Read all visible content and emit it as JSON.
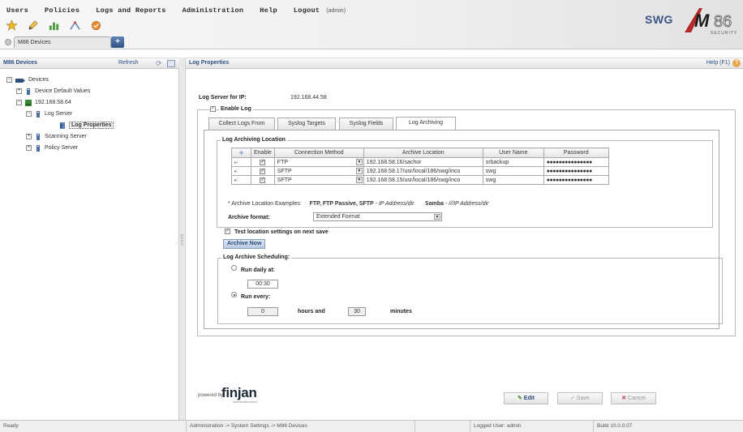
{
  "menu": {
    "items": [
      "Users",
      "Policies",
      "Logs and Reports",
      "Administration",
      "Help",
      "Logout"
    ],
    "user_tag": "(admin)"
  },
  "toolbar_icons": [
    "star-icon",
    "pencil-icon",
    "chart-icon",
    "signal-icon",
    "badge-icon"
  ],
  "device_tab": {
    "label": "M86 Devices",
    "add_label": "+"
  },
  "brand": {
    "product": "SWG",
    "logo_text": "M86",
    "logo_sub": "SECURITY",
    "accent": "#3c5584",
    "logo_red": "#b22a2a"
  },
  "left_panel": {
    "title": "M86 Devices",
    "refresh_label": "Refresh",
    "tree": [
      {
        "label": "Devices",
        "level": 0,
        "expander": "−",
        "icon": "devices-icon"
      },
      {
        "label": "Device Default Values",
        "level": 1,
        "expander": "+",
        "icon": "device-defaults-icon"
      },
      {
        "label": "192.168.58.64",
        "level": 1,
        "expander": "−",
        "icon": "appliance-icon"
      },
      {
        "label": "Log Server",
        "level": 2,
        "expander": "−",
        "icon": "server-icon"
      },
      {
        "label": "Log Properties",
        "level": 3,
        "expander": "",
        "icon": "properties-icon",
        "selected": true
      },
      {
        "label": "Scanning Server",
        "level": 2,
        "expander": "+",
        "icon": "server-icon"
      },
      {
        "label": "Policy Server",
        "level": 2,
        "expander": "+",
        "icon": "server-icon"
      }
    ]
  },
  "right_panel": {
    "title": "Log Properties",
    "help_label": "Help (F1)",
    "log_server_label": "Log Server for IP:",
    "log_server_ip": "192.168.44.58",
    "enable_log_label": "Enable Log",
    "tabs": [
      "Collect Logs From",
      "Syslog Targets",
      "Syslog Fields",
      "Log Archiving"
    ],
    "active_tab": "Log Archiving",
    "archiving_location_title": "Log Archiving Location",
    "table_headers": [
      "",
      "Enable",
      "Connection Method",
      "Archive Location",
      "User Name",
      "Password"
    ],
    "table_rows": [
      {
        "enabled": true,
        "method": "FTP",
        "location": "192.168.58.16/sachor",
        "user": "srbackup",
        "password": "●●●●●●●●●●●●●●●"
      },
      {
        "enabled": true,
        "method": "SFTP",
        "location": "192.168.58.17/usr/local/186/swg/inco",
        "user": "swg",
        "password": "●●●●●●●●●●●●●●●"
      },
      {
        "enabled": true,
        "method": "SFTP",
        "location": "192.168.58.15/usr/local/186/swg/inco",
        "user": "swg",
        "password": "●●●●●●●●●●●●●●●"
      }
    ],
    "examples_prefix": "* Archive Location Examples:",
    "examples_ftp_bold": "FTP, FTP Passive, SFTP",
    "examples_ftp_rest": " - IP Address/dir.",
    "examples_samba_bold": "Samba",
    "examples_samba_rest": " - ///IP Address/dir",
    "archive_format_label": "Archive format:",
    "archive_format_value": "Extended Format",
    "test_location_label": "Test location settings on next save",
    "archive_now_label": "Archive Now",
    "scheduling_title": "Log Archive Scheduling:",
    "run_daily_label": "Run daily at:",
    "run_daily_time": "00:30",
    "run_every_label": "Run every:",
    "hours_value": "0",
    "hours_label": "hours and",
    "minutes_value": "30",
    "minutes_label": "minutes",
    "powered_by": "powered by",
    "finjan": "finjan",
    "finjan_sub": "SECURE BROWSING",
    "buttons": {
      "edit": "Edit",
      "save": "Save",
      "cancel": "Cancel"
    }
  },
  "status_bar": {
    "ready": "Ready",
    "breadcrumb": "Administration -> System Settings -> M86 Devices",
    "logged_user": "Logged User: admin",
    "build": "Build 10.0.0.07"
  }
}
